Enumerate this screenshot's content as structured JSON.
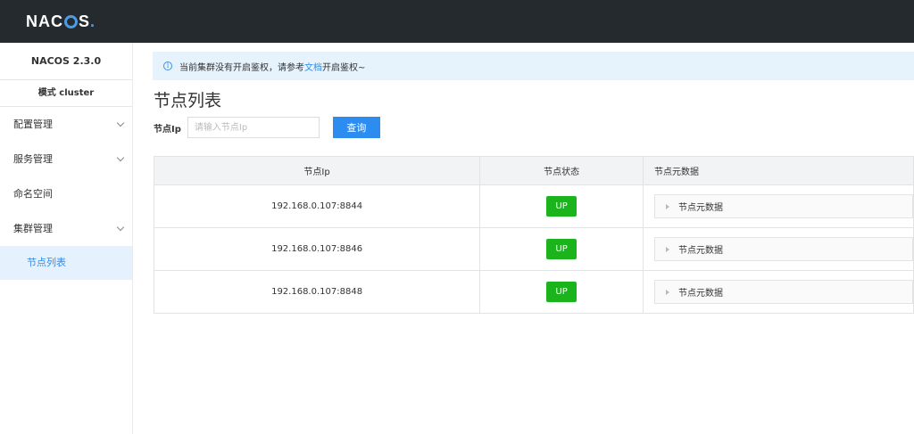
{
  "header": {
    "logo_prefix": "NAC",
    "logo_suffix": "S",
    "logo_dot": "."
  },
  "sidebar": {
    "version": "NACOS 2.3.0",
    "mode": "模式 cluster",
    "items": [
      {
        "label": "配置管理",
        "icon": "chevron-down-icon"
      },
      {
        "label": "服务管理",
        "icon": "chevron-down-icon"
      },
      {
        "label": "命名空间"
      },
      {
        "label": "集群管理",
        "icon": "chevron-down-icon"
      }
    ],
    "sub_item": "节点列表"
  },
  "notice": {
    "icon": "info-icon",
    "text_before": "当前集群没有开启鉴权，请参考",
    "link": "文档",
    "text_after": "开启鉴权~",
    "color": "#e6f3fd"
  },
  "page": {
    "title": "节点列表",
    "filter_label": "节点Ip",
    "filter_placeholder": "请输入节点Ip",
    "query_button": "查询"
  },
  "table": {
    "headers": [
      "节点Ip",
      "节点状态",
      "节点元数据"
    ],
    "rows": [
      {
        "ip": "192.168.0.107:8844",
        "state": "UP",
        "meta": "节点元数据"
      },
      {
        "ip": "192.168.0.107:8846",
        "state": "UP",
        "meta": "节点元数据"
      },
      {
        "ip": "192.168.0.107:8848",
        "state": "UP",
        "meta": "节点元数据"
      }
    ]
  },
  "colors": {
    "topbar": "#252a2f",
    "accent": "#2d8cf0",
    "status_up": "#1cb41c"
  }
}
